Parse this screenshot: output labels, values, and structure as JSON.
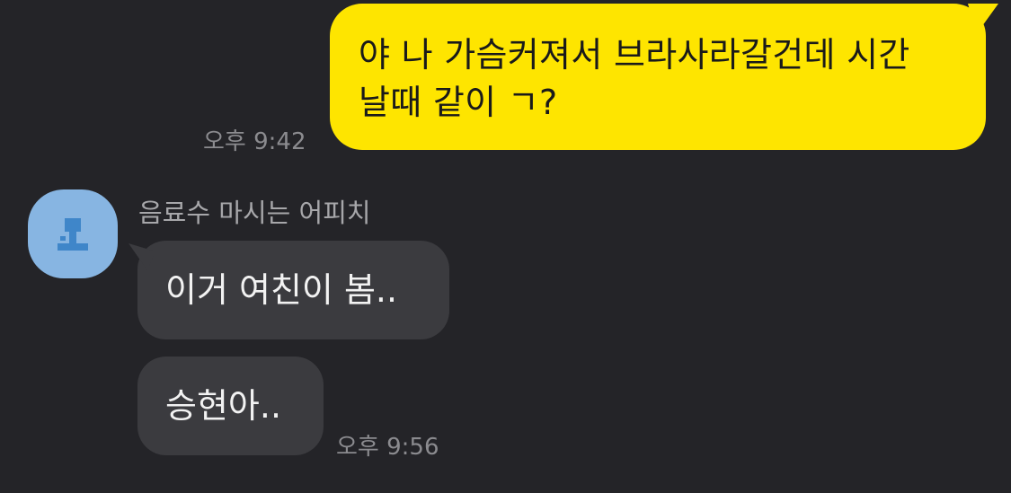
{
  "messages": {
    "outgoing": {
      "text": "야 나 가슴커져서 브라사라갈건데 시간\n날때 같이 ㄱ?",
      "time": "오후 9:42"
    },
    "incoming": {
      "sender": "음료수 마시는 어피치",
      "bubbles": [
        "이거 여친이 봄..",
        "승현아.."
      ],
      "time": "오후 9:56"
    }
  },
  "colors": {
    "background": "#242428",
    "outgoing_bubble": "#FEE500",
    "incoming_bubble": "#3b3b3f",
    "avatar": "#87b5e2"
  },
  "icons": {
    "avatar": "default-profile-icon"
  }
}
